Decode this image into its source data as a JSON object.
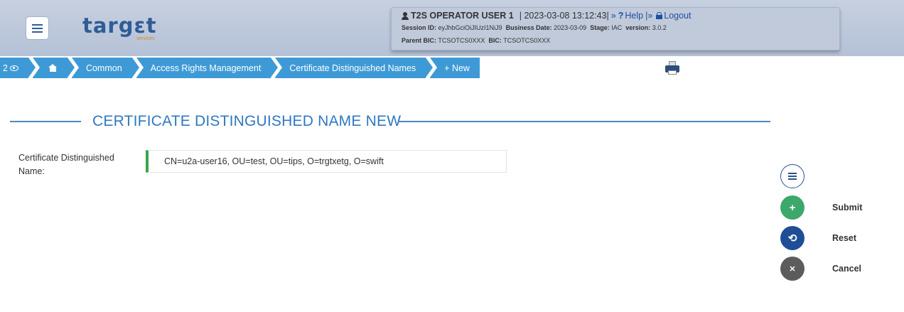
{
  "header": {
    "logo_text": "targɛt",
    "logo_sub": "services",
    "user_name": "T2S OPERATOR USER 1",
    "datetime": "| 2023-03-08 13:12:43|",
    "help_label": "Help",
    "logout_label": "Logout",
    "session_label": "Session ID:",
    "session_value": "eyJhbGciOiJIUzI1NiJ9",
    "business_date_label": "Business Date:",
    "business_date_value": "2023-03-09",
    "stage_label": "Stage:",
    "stage_value": "IAC",
    "version_label": "version:",
    "version_value": "3.0.2",
    "parent_bic_label": "Parent BIC:",
    "parent_bic_value": "TCSOTCS0XXX",
    "bic_label": "BIC:",
    "bic_value": "TCSOTCS0XXX"
  },
  "breadcrumb": {
    "count": "2",
    "items": [
      "Common",
      "Access Rights Management",
      "Certificate Distinguished Names",
      "+ New"
    ]
  },
  "page": {
    "title": "CERTIFICATE DISTINGUISHED NAME NEW"
  },
  "form": {
    "label": "Certificate Distinguished Name:",
    "value": "CN=u2a-user16, OU=test, OU=tips, O=trgtxetg, O=swift"
  },
  "actions": {
    "submit": "Submit",
    "reset": "Reset",
    "cancel": "Cancel"
  },
  "icons": {
    "menu": "hamburger-icon",
    "user": "user-icon",
    "help": "question-icon",
    "logout": "lock-icon",
    "print": "printer-icon",
    "eye": "eye-icon",
    "home": "home-icon",
    "list": "list-icon",
    "submit": "plus-icon",
    "reset": "undo-icon",
    "cancel": "close-icon"
  },
  "colors": {
    "accent": "#3e9ad6",
    "title": "#2f78c2",
    "submit": "#3ca86b",
    "reset": "#1f4e96",
    "cancel": "#5c5c5c",
    "input_border": "#3aa54a"
  }
}
